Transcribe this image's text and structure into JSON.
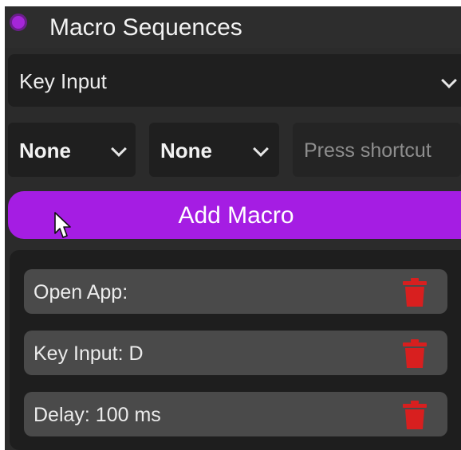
{
  "header": {
    "title": "Macro Sequences"
  },
  "action_select": {
    "value": "Key Input"
  },
  "modifier_1": {
    "value": "None"
  },
  "modifier_2": {
    "value": "None"
  },
  "shortcut_input": {
    "placeholder": "Press shortcut",
    "value": ""
  },
  "add_button": {
    "label": "Add Macro"
  },
  "macros": [
    {
      "label": "Open App:"
    },
    {
      "label": "Key Input: D"
    },
    {
      "label": "Delay: 100 ms"
    }
  ],
  "colors": {
    "accent": "#a51de3",
    "delete": "#d81f1f",
    "background": "#2b2b2b"
  },
  "icons": {
    "header": "record-dot-icon",
    "dropdown": "chevron-down-icon",
    "delete": "trash-icon",
    "cursor": "mouse-pointer-icon"
  }
}
